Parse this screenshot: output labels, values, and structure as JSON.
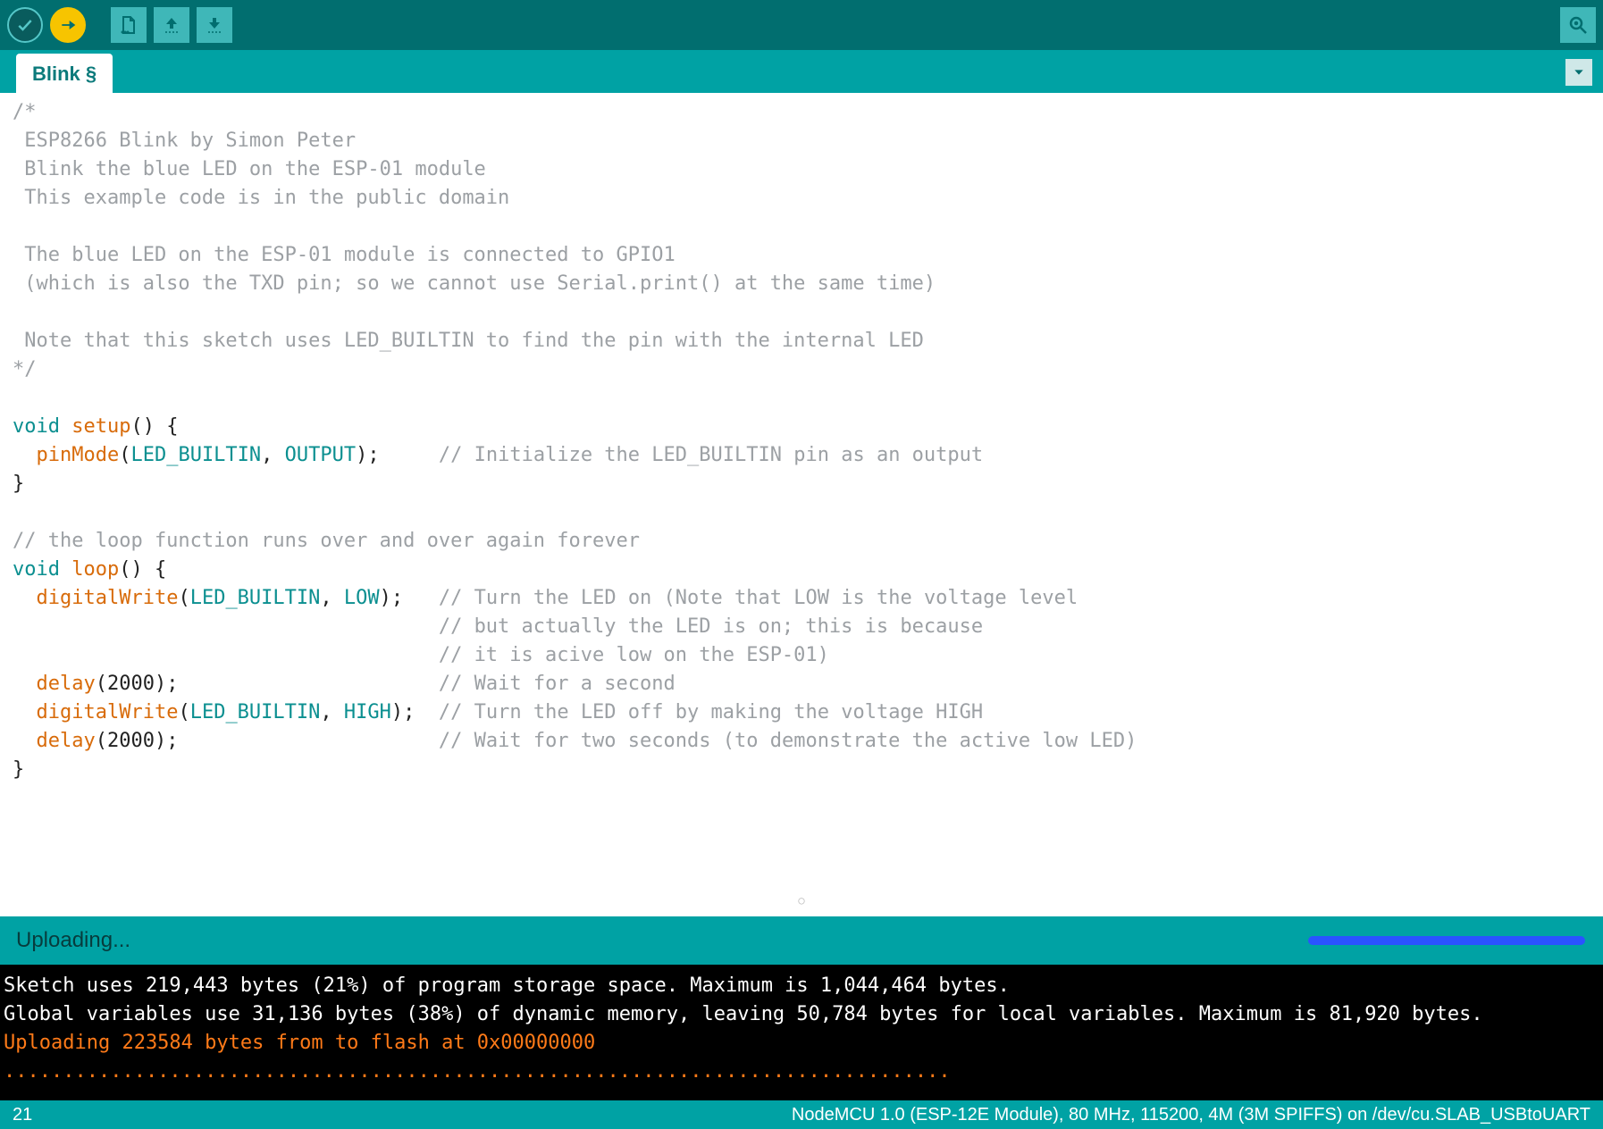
{
  "toolbar": {
    "verify_tooltip": "Verify",
    "upload_tooltip": "Upload",
    "new_tooltip": "New",
    "open_tooltip": "Open",
    "save_tooltip": "Save",
    "serial_monitor_tooltip": "Serial Monitor"
  },
  "tabs": {
    "active": "Blink",
    "dirty_marker": "§"
  },
  "code": {
    "lines": [
      {
        "t": "comment",
        "text": "/*"
      },
      {
        "t": "comment",
        "text": " ESP8266 Blink by Simon Peter"
      },
      {
        "t": "comment",
        "text": " Blink the blue LED on the ESP-01 module"
      },
      {
        "t": "comment",
        "text": " This example code is in the public domain"
      },
      {
        "t": "comment",
        "text": ""
      },
      {
        "t": "comment",
        "text": " The blue LED on the ESP-01 module is connected to GPIO1"
      },
      {
        "t": "comment",
        "text": " (which is also the TXD pin; so we cannot use Serial.print() at the same time)"
      },
      {
        "t": "comment",
        "text": ""
      },
      {
        "t": "comment",
        "text": " Note that this sketch uses LED_BUILTIN to find the pin with the internal LED"
      },
      {
        "t": "comment",
        "text": "*/"
      },
      {
        "t": "blank",
        "text": ""
      },
      {
        "t": "code",
        "seg": [
          [
            "kw",
            "void "
          ],
          [
            "builtin",
            "setup"
          ],
          [
            "punc",
            "() {"
          ]
        ]
      },
      {
        "t": "code",
        "seg": [
          [
            "punc",
            "  "
          ],
          [
            "builtin",
            "pinMode"
          ],
          [
            "punc",
            "("
          ],
          [
            "const",
            "LED_BUILTIN"
          ],
          [
            "punc",
            ", "
          ],
          [
            "const",
            "OUTPUT"
          ],
          [
            "punc",
            ");     "
          ],
          [
            "comment",
            "// Initialize the LED_BUILTIN pin as an output"
          ]
        ]
      },
      {
        "t": "code",
        "seg": [
          [
            "punc",
            "}"
          ]
        ]
      },
      {
        "t": "blank",
        "text": ""
      },
      {
        "t": "comment",
        "text": "// the loop function runs over and over again forever"
      },
      {
        "t": "code",
        "seg": [
          [
            "kw",
            "void "
          ],
          [
            "builtin",
            "loop"
          ],
          [
            "punc",
            "() {"
          ]
        ]
      },
      {
        "t": "code",
        "seg": [
          [
            "punc",
            "  "
          ],
          [
            "builtin",
            "digitalWrite"
          ],
          [
            "punc",
            "("
          ],
          [
            "const",
            "LED_BUILTIN"
          ],
          [
            "punc",
            ", "
          ],
          [
            "const",
            "LOW"
          ],
          [
            "punc",
            ");   "
          ],
          [
            "comment",
            "// Turn the LED on (Note that LOW is the voltage level"
          ]
        ]
      },
      {
        "t": "code",
        "seg": [
          [
            "punc",
            "                                    "
          ],
          [
            "comment",
            "// but actually the LED is on; this is because"
          ]
        ]
      },
      {
        "t": "code",
        "seg": [
          [
            "punc",
            "                                    "
          ],
          [
            "comment",
            "// it is acive low on the ESP-01)"
          ]
        ]
      },
      {
        "t": "code",
        "seg": [
          [
            "punc",
            "  "
          ],
          [
            "builtin",
            "delay"
          ],
          [
            "punc",
            "("
          ],
          [
            "num",
            "2000"
          ],
          [
            "punc",
            ");                      "
          ],
          [
            "comment",
            "// Wait for a second"
          ]
        ]
      },
      {
        "t": "code",
        "seg": [
          [
            "punc",
            "  "
          ],
          [
            "builtin",
            "digitalWrite"
          ],
          [
            "punc",
            "("
          ],
          [
            "const",
            "LED_BUILTIN"
          ],
          [
            "punc",
            ", "
          ],
          [
            "const",
            "HIGH"
          ],
          [
            "punc",
            ");  "
          ],
          [
            "comment",
            "// Turn the LED off by making the voltage HIGH"
          ]
        ]
      },
      {
        "t": "code",
        "seg": [
          [
            "punc",
            "  "
          ],
          [
            "builtin",
            "delay"
          ],
          [
            "punc",
            "("
          ],
          [
            "num",
            "2000"
          ],
          [
            "punc",
            ");                      "
          ],
          [
            "comment",
            "// Wait for two seconds (to demonstrate the active low LED)"
          ]
        ]
      },
      {
        "t": "code",
        "seg": [
          [
            "punc",
            "}"
          ]
        ]
      }
    ]
  },
  "status": {
    "label": "Uploading...",
    "progress_percent": 100
  },
  "console": {
    "lines": [
      {
        "cls": "",
        "text": "Sketch uses 219,443 bytes (21%) of program storage space. Maximum is 1,044,464 bytes."
      },
      {
        "cls": "",
        "text": "Global variables use 31,136 bytes (38%) of dynamic memory, leaving 50,784 bytes for local variables. Maximum is 81,920 bytes."
      },
      {
        "cls": "orange",
        "text": "Uploading 223584 bytes from to flash at 0x00000000"
      },
      {
        "cls": "orange",
        "text": "................................................................................"
      }
    ]
  },
  "footer": {
    "line_number": "21",
    "board_info": "NodeMCU 1.0 (ESP-12E Module), 80 MHz, 115200, 4M (3M SPIFFS) on /dev/cu.SLAB_USBtoUART"
  }
}
